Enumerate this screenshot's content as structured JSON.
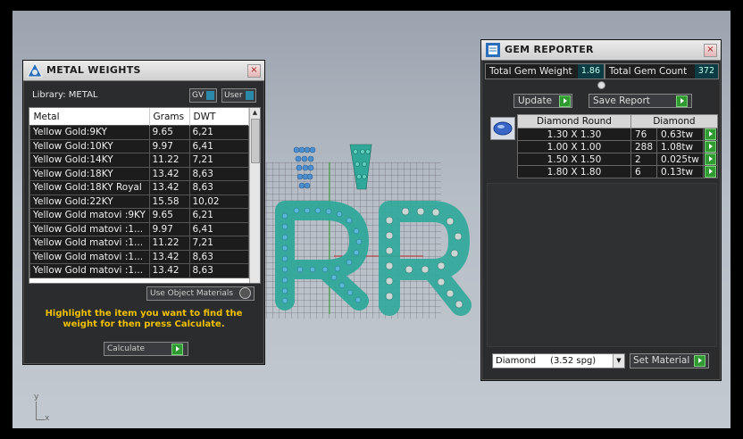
{
  "metal_weights": {
    "title": "METAL WEIGHTS",
    "library_label": "Library: METAL",
    "gv_label": "GV",
    "user_label": "User",
    "columns": [
      "Metal",
      "Grams",
      "DWT"
    ],
    "rows": [
      [
        "Yellow Gold:9KY",
        "9.65",
        "6,21"
      ],
      [
        "Yellow Gold:10KY",
        "9.97",
        "6,41"
      ],
      [
        "Yellow Gold:14KY",
        "11.22",
        "7,21"
      ],
      [
        "Yellow Gold:18KY",
        "13.42",
        "8,63"
      ],
      [
        "Yellow Gold:18KY Royal",
        "13.42",
        "8,63"
      ],
      [
        "Yellow Gold:22KY",
        "15.58",
        "10,02"
      ],
      [
        "Yellow Gold matovi :9KY",
        "9.65",
        "6,21"
      ],
      [
        "Yellow Gold matovi :1...",
        "9.97",
        "6,41"
      ],
      [
        "Yellow Gold matovi :1...",
        "11.22",
        "7,21"
      ],
      [
        "Yellow Gold matovi :1...",
        "13.42",
        "8,63"
      ],
      [
        "Yellow Gold matovi :1...",
        "13.42",
        "8,63"
      ]
    ],
    "use_object_materials": "Use Object Materials",
    "hint": "Highlight the item you want to find the weight for then press Calculate.",
    "calculate_label": "Calculate"
  },
  "gem_reporter": {
    "title": "GEM REPORTER",
    "total_gem_weight_label": "Total Gem Weight",
    "total_gem_weight": "1.86",
    "total_gem_count_label": "Total Gem Count",
    "total_gem_count": "372",
    "update_label": "Update",
    "save_report_label": "Save Report",
    "table_header_shape": "Diamond Round",
    "table_header_material": "Diamond",
    "rows": [
      [
        "1.30 X 1.30",
        "76",
        "0.63tw"
      ],
      [
        "1.00 X 1.00",
        "288",
        "1.08tw"
      ],
      [
        "1.50 X 1.50",
        "2",
        "0.025tw"
      ],
      [
        "1.80 X 1.80",
        "6",
        "0.13tw"
      ]
    ],
    "material_select": "Diamond     (3.52 spg)",
    "set_material_label": "Set Material"
  },
  "viewport": {
    "axis_y": "y",
    "axis_x": "x"
  },
  "colors": {
    "gem_teal": "#2fa89a",
    "gem_blue": "#4c8fd0",
    "accent_green": "#2f9a2f",
    "hint_yellow": "#f0c000"
  }
}
